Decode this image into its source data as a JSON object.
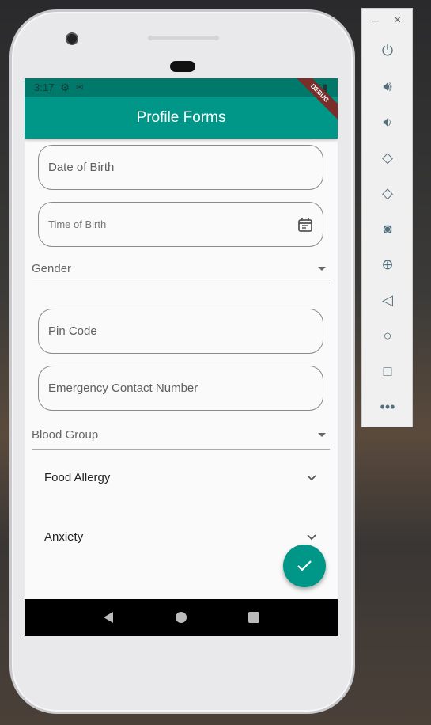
{
  "status": {
    "time": "3:17"
  },
  "appbar": {
    "title": "Profile Forms",
    "debug": "DEBUG"
  },
  "form": {
    "dob": "Date of Birth",
    "tob": "Time of Birth",
    "gender": "Gender",
    "pin": "Pin Code",
    "emergency": "Emergency Contact Number",
    "blood": "Blood Group",
    "food_allergy": "Food Allergy",
    "anxiety": "Anxiety"
  },
  "colors": {
    "primary": "#009688",
    "status": "#00796b"
  },
  "emulator": {
    "minimize": "−",
    "close": "×"
  }
}
